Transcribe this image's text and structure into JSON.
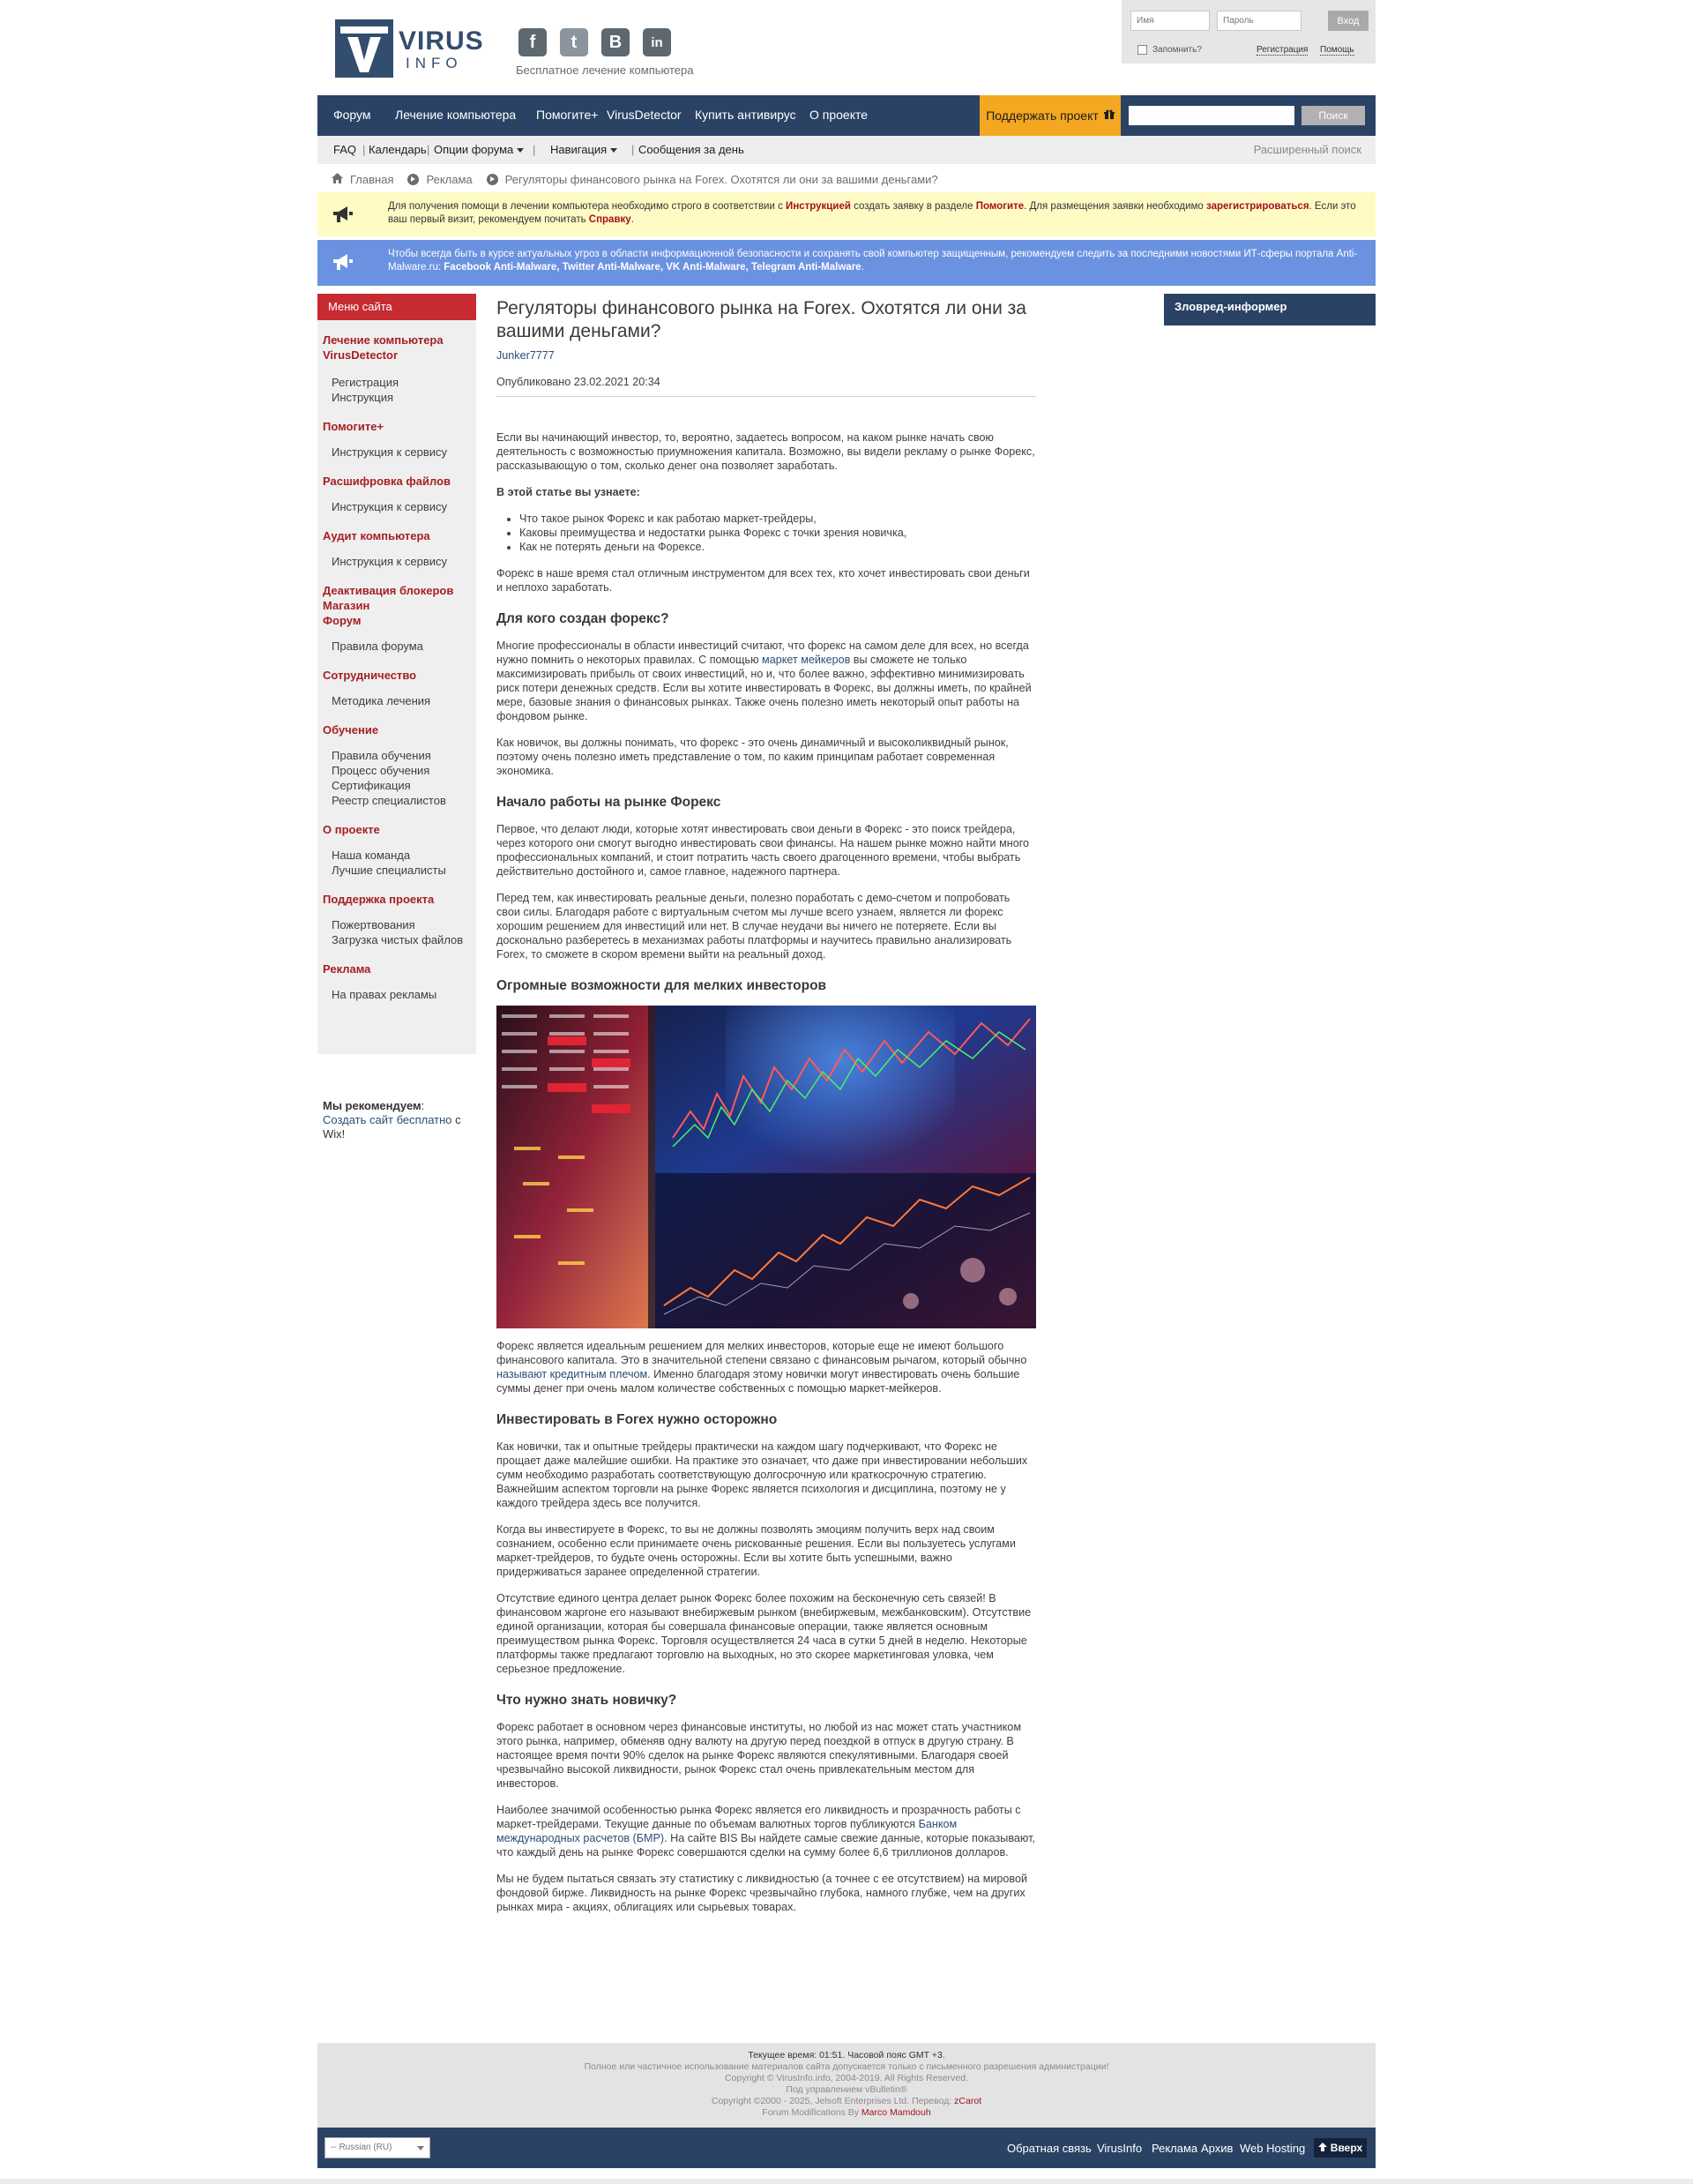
{
  "header": {
    "logo_line1": "VIRUS",
    "logo_line2": "INFO",
    "socials": [
      "f",
      "t",
      "B",
      "in"
    ],
    "tagline": "Бесплатное лечение компьютера"
  },
  "login": {
    "username_placeholder": "Имя",
    "password_placeholder": "Пароль",
    "login_button": "Вход",
    "remember": "Запомнить?",
    "register": "Регистрация",
    "help": "Помощь"
  },
  "nav": {
    "items": [
      "Форум",
      "Лечение компьютера",
      "Помогите+",
      "VirusDetector",
      "Купить антивирус",
      "О проекте"
    ],
    "support": "Поддержать проект",
    "search_button": "Поиск"
  },
  "subnav": {
    "items": [
      "FAQ",
      "Календарь",
      "Опции форума",
      "Навигация",
      "Сообщения за день"
    ],
    "advanced_search": "Расширенный поиск"
  },
  "breadcrumbs": [
    "Главная",
    "Реклама",
    "Регуляторы финансового рынка на Forex. Охотятся ли они за вашими деньгами?"
  ],
  "notice1": {
    "t1": "Для получения помощи в лечении компьютера необходимо строго в соответствии с ",
    "l1": "Инструкцией",
    "t2": " создать заявку в разделе ",
    "l2": "Помогите",
    "t3": ". Для размещения заявки необходимо ",
    "l3": "зарегистрироваться",
    "t4": ". Если это ваш первый визит, рекомендуем почитать ",
    "l4": "Справку",
    "t5": "."
  },
  "notice2": {
    "t1": "Чтобы всегда быть в курсе актуальных угроз в области информационной безопасности и сохранять свой компьютер защищенным, рекомендуем следить за последними новостями ИТ-сферы портала Anti-Malware.ru: ",
    "links": "Facebook Anti-Malware, Twitter Anti-Malware, VK Anti-Malware, Telegram Anti-Malware",
    "t2": "."
  },
  "sidebar": {
    "title": "Меню сайта",
    "groups": [
      {
        "cat": "Лечение компьютера",
        "cat2": "VirusDetector",
        "subs": [
          "Регистрация",
          "Инструкция"
        ]
      },
      {
        "cat": "Помогите+",
        "subs": [
          "Инструкция к сервису"
        ]
      },
      {
        "cat": "Расшифровка файлов",
        "subs": [
          "Инструкция к сервису"
        ]
      },
      {
        "cat": "Аудит компьютера",
        "subs": [
          "Инструкция к сервису"
        ]
      },
      {
        "cat": "Деактивация блокеров",
        "cat2": "Магазин",
        "cat3": "Форум",
        "subs": [
          "Правила форума"
        ]
      },
      {
        "cat": "Сотрудничество",
        "subs": [
          "Методика лечения"
        ]
      },
      {
        "cat": "Обучение",
        "subs": [
          "Правила обучения",
          "Процесс обучения",
          "Сертификация",
          "Реестр специалистов"
        ]
      },
      {
        "cat": "О проекте",
        "subs": [
          "Наша команда",
          "Лучшие специалисты"
        ]
      },
      {
        "cat": "Поддержка проекта",
        "subs": [
          "Пожертвования",
          "Загрузка чистых файлов"
        ]
      },
      {
        "cat": "Реклама",
        "subs": [
          "На правах рекламы"
        ]
      }
    ],
    "recommend_label": "Мы рекомендуем",
    "recommend_colon": ":",
    "recommend_link": "Создать сайт бесплатно",
    "recommend_tail": " с Wix!"
  },
  "right_sidebar": {
    "title": "Зловред-информер"
  },
  "article": {
    "title": "Регуляторы финансового рынка на Forex. Охотятся ли они за вашими деньгами?",
    "author": "Junker7777",
    "date": "Опубликовано 23.02.2021 20:34",
    "p1": "Если вы начинающий инвестор, то, вероятно, задаетесь вопросом, на каком рынке начать свою деятельность с возможностью приумножения капитала. Возможно, вы видели рекламу о рынке Форекс, рассказывающую о том, сколько денег она позволяет заработать.",
    "learn_heading": "В этой статье вы узнаете:",
    "bullets": [
      "Что такое рынок Форекс и как работаю маркет-трейдеры,",
      "Каковы преимущества и недостатки рынка Форекс с точки зрения новичка,",
      "Как не потерять деньги на Форексе."
    ],
    "p2": "Форекс в наше время стал отличным инструментом для всех тех, кто хочет инвестировать свои деньги и неплохо заработать.",
    "h1": "Для кого создан форекс?",
    "p3a": "Многие профессионалы в области инвестиций считают, что форекс на самом деле для всех, но всегда нужно помнить о некоторых правилах. С помощью ",
    "p3link": "маркет мейкеров",
    "p3b": " вы сможете не только максимизировать прибыль от своих инвестиций, но и, что более важно, эффективно минимизировать риск потери денежных средств. Если вы хотите инвестировать в Форекс, вы должны иметь, по крайней мере, базовые знания о финансовых рынках. Также очень полезно иметь некоторый опыт работы на фондовом рынке.",
    "p4": "Как новичок, вы должны понимать, что форекс - это очень динамичный и высоколиквидный рынок, поэтому очень полезно иметь представление о том, по каким принципам работает современная экономика.",
    "h2": "Начало работы на рынке Форекс",
    "p5": "Первое, что делают люди, которые хотят инвестировать свои деньги в Форекс - это поиск трейдера, через которого они смогут выгодно инвестировать свои финансы. На нашем рынке можно найти много профессиональных компаний, и стоит потратить часть своего драгоценного времени, чтобы выбрать действительно достойного и, самое главное, надежного партнера.",
    "p6": "Перед тем, как инвестировать реальные деньги, полезно поработать с демо-счетом и попробовать свои силы. Благодаря работе с виртуальным счетом мы лучше всего узнаем, является ли форекс хорошим решением для инвестиций или нет. В случае неудачи вы ничего не потеряете. Если вы досконально разберетесь в механизмах работы платформы и научитесь правильно анализировать Forex, то сможете в скором времени выйти на реальный доход.",
    "h3": "Огромные возможности для мелких инвесторов",
    "p7a": "Форекс является идеальным решением для мелких инвесторов, которые еще не имеют большого финансового капитала. Это в значительной степени связано с финансовым рычагом, который обычно ",
    "p7link": "называют кредитным плечом",
    "p7b": ". Именно благодаря этому новички могут инвестировать очень большие суммы денег при очень малом количестве собственных с помощью маркет-мейкеров.",
    "h4": "Инвестировать в Forex нужно осторожно",
    "p8": "Как новички, так и опытные трейдеры практически на каждом шагу подчеркивают, что Форекс не прощает даже малейшие ошибки. На практике это означает, что даже при инвестировании небольших сумм необходимо разработать соответствующую долгосрочную или краткосрочную стратегию. Важнейшим аспектом торговли на рынке Форекс является психология и дисциплина, поэтому не у каждого трейдера здесь все получится.",
    "p9": "Когда вы инвестируете в Форекс, то вы не должны позволять эмоциям получить верх над своим сознанием, особенно если принимаете очень рискованные решения. Если вы пользуетесь услугами маркет-трейдеров, то будьте очень осторожны. Если вы хотите быть успешными, важно придерживаться заранее определенной стратегии.",
    "p10": "Отсутствие единого центра делает рынок Форекс более похожим на бесконечную сеть связей! В финансовом жаргоне его называют внебиржевым рынком (внебиржевым, межбанковским). Отсутствие единой организации, которая бы совершала финансовые операции, также является основным преимуществом рынка Форекс. Торговля осуществляется 24 часа в сутки 5 дней в неделю. Некоторые платформы также предлагают торговлю на выходных, но это скорее маркетинговая уловка, чем серьезное предложение.",
    "h5": "Что нужно знать новичку?",
    "p11": "Форекс работает в основном через финансовые институты, но любой из нас может стать участником этого рынка, например, обменяв одну валюту на другую перед поездкой в отпуск в другую страну. В настоящее время почти 90% сделок на рынке Форекс являются спекулятивными. Благодаря своей чрезвычайно высокой ликвидности, рынок Форекс стал очень привлекательным местом для инвесторов.",
    "p12a": "Наиболее значимой особенностью рынка Форекс является его ликвидность и прозрачность работы с маркет-трейдерами. Текущие данные по объемам валютных торгов публикуются ",
    "p12link": "Банком международных расчетов (БМР)",
    "p12b": ". На сайте BIS Вы найдете самые свежие данные, которые показывают, что каждый день на рынке Форекс совершаются сделки на сумму более 6,6 триллионов долларов.",
    "p13": "Мы не будем пытаться связать эту статистику с ликвидностью (а точнее с ее отсутствием) на мировой фондовой бирже. Ликвидность на рынке Форекс чрезвычайно глубока, намного глубже, чем на других рынках мира - акциях, облигациях или сырьевых товарах."
  },
  "footer": {
    "time": "Текущее время: 01:51. Часовой пояс GMT +3.",
    "line2": "Полное или частичное использование материалов сайта допускается только с письменного разрешения администрации!",
    "line3": "Copyright © VirusInfo.info, 2004-2019. All Rights Reserved.",
    "line4": "Под управлением vBulletin®",
    "line5a": "Copyright ©2000 - 2025, Jelsoft Enterprises Ltd. Перевод: ",
    "line5link": "zCarot",
    "line6a": "Forum Modifications By ",
    "line6link": "Marco Mamdouh",
    "lang": "-- Russian (RU)",
    "links": [
      "Обратная связь",
      "VirusInfo",
      "Реклама",
      "Архив",
      "Web Hosting"
    ],
    "up": "Вверх"
  }
}
